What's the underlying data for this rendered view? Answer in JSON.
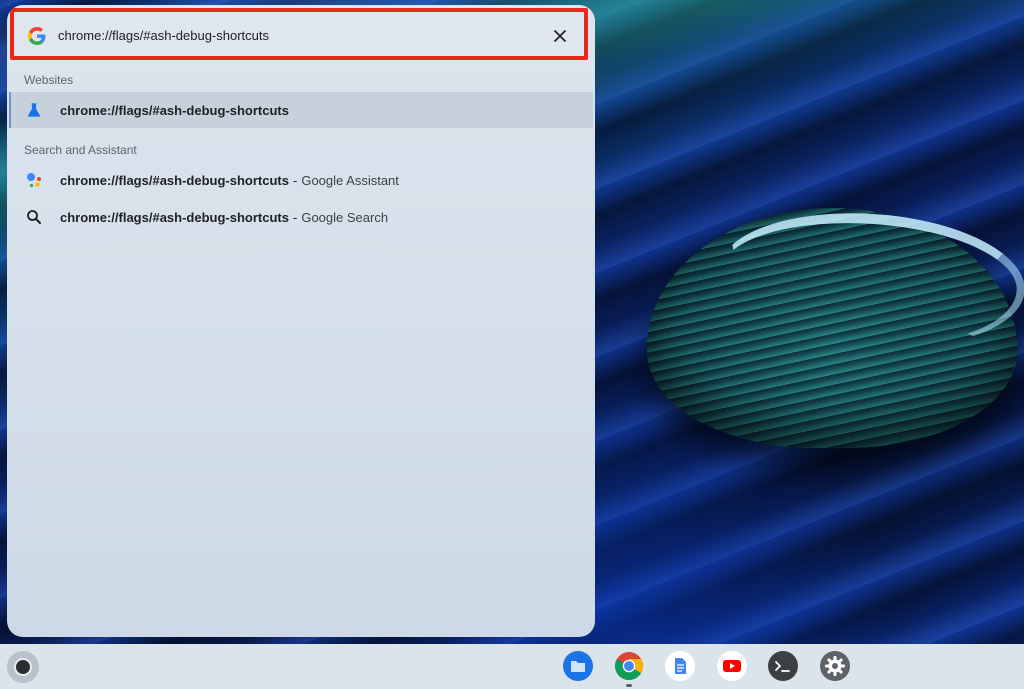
{
  "search": {
    "value": "chrome://flags/#ash-debug-shortcuts",
    "highlight_color": "#e8281b"
  },
  "sections": {
    "websites": {
      "header": "Websites",
      "results": [
        {
          "title": "chrome://flags/#ash-debug-shortcuts",
          "icon": "flask-icon"
        }
      ]
    },
    "search_assistant": {
      "header": "Search and Assistant",
      "results": [
        {
          "title": "chrome://flags/#ash-debug-shortcuts",
          "separator": "-",
          "description": "Google Assistant",
          "icon": "google-assistant-icon"
        },
        {
          "title": "chrome://flags/#ash-debug-shortcuts",
          "separator": "-",
          "description": "Google Search",
          "icon": "search-icon"
        }
      ]
    }
  },
  "shelf": {
    "apps": [
      {
        "name": "Files",
        "icon": "files-icon"
      },
      {
        "name": "Chrome",
        "icon": "chrome-icon",
        "running": true
      },
      {
        "name": "Docs",
        "icon": "docs-icon"
      },
      {
        "name": "YouTube",
        "icon": "youtube-icon"
      },
      {
        "name": "Terminal",
        "icon": "terminal-icon"
      },
      {
        "name": "Settings",
        "icon": "settings-icon"
      }
    ]
  },
  "colors": {
    "accent": "#1a73e8",
    "selected_row": "#c6d1dc"
  }
}
